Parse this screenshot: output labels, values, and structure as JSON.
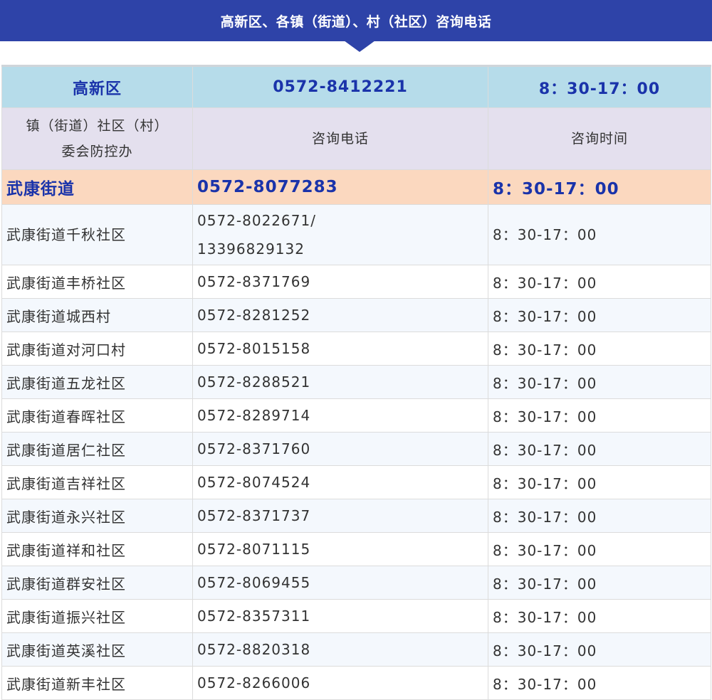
{
  "banner": {
    "title": "高新区、各镇（街道）、村（社区）咨询电话"
  },
  "district": {
    "name": "高新区",
    "phone": "0572-8412221",
    "hours": "8：30-17：00"
  },
  "header": {
    "col1_line1": "镇（街道）社区（村）",
    "col1_line2": "委会防控办",
    "col2": "咨询电话",
    "col3": "咨询时间"
  },
  "street": {
    "name": "武康街道",
    "phone": "0572-8077283",
    "hours": "8：30-17：00"
  },
  "rows": [
    {
      "name": "武康街道千秋社区",
      "phone": "0572-8022671/",
      "phone2": "13396829132",
      "hours": "8：30-17：00"
    },
    {
      "name": "武康街道丰桥社区",
      "phone": "0572-8371769",
      "hours": "8：30-17：00"
    },
    {
      "name": "武康街道城西村",
      "phone": "0572-8281252",
      "hours": "8：30-17：00"
    },
    {
      "name": "武康街道对河口村",
      "phone": "0572-8015158",
      "hours": "8：30-17：00"
    },
    {
      "name": "武康街道五龙社区",
      "phone": "0572-8288521",
      "hours": "8：30-17：00"
    },
    {
      "name": "武康街道春晖社区",
      "phone": "0572-8289714",
      "hours": "8：30-17：00"
    },
    {
      "name": "武康街道居仁社区",
      "phone": "0572-8371760",
      "hours": "8：30-17：00"
    },
    {
      "name": "武康街道吉祥社区",
      "phone": "0572-8074524",
      "hours": "8：30-17：00"
    },
    {
      "name": "武康街道永兴社区",
      "phone": "0572-8371737",
      "hours": "8：30-17：00"
    },
    {
      "name": "武康街道祥和社区",
      "phone": "0572-8071115",
      "hours": "8：30-17：00"
    },
    {
      "name": "武康街道群安社区",
      "phone": "0572-8069455",
      "hours": "8：30-17：00"
    },
    {
      "name": "武康街道振兴社区",
      "phone": "0572-8357311",
      "hours": "8：30-17：00"
    },
    {
      "name": "武康街道英溪社区",
      "phone": "0572-8820318",
      "hours": "8：30-17：00"
    },
    {
      "name": "武康街道新丰社区",
      "phone": "0572-8266006",
      "hours": "8：30-17：00"
    }
  ]
}
